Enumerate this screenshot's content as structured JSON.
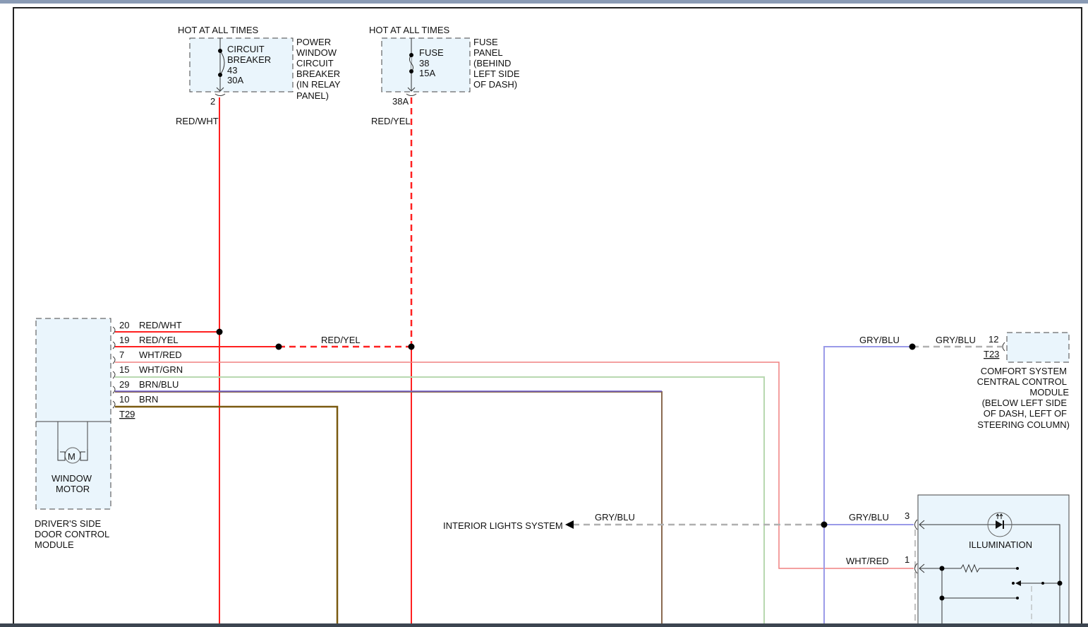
{
  "title": "Power window wiring diagram",
  "colors": {
    "red": "#ff2020",
    "wht_red": "#f08080",
    "wht_grn": "#b8d8b0",
    "brn_blu": "#6a5acd",
    "brn": "#7a5a10",
    "gry_blu": "#9a9ae8",
    "gry": "#b0b0b0",
    "module_fill": "#eaf5fc"
  },
  "power": [
    {
      "hot": "HOT AT ALL TIMES",
      "device": [
        "CIRCUIT",
        "BREAKER",
        "43",
        "30A"
      ],
      "location": [
        "POWER",
        "WINDOW",
        "CIRCUIT",
        "BREAKER",
        "(IN RELAY",
        "PANEL)"
      ],
      "pin": "2",
      "wire": "RED/WHT"
    },
    {
      "hot": "HOT AT ALL TIMES",
      "device": [
        "FUSE",
        "38",
        "15A"
      ],
      "location": [
        "FUSE",
        "PANEL",
        "(BEHIND",
        "LEFT SIDE",
        "OF DASH)"
      ],
      "pin": "38A",
      "wire": "RED/YEL"
    }
  ],
  "door_module": {
    "connector": "T29",
    "pins": [
      {
        "pin": "20",
        "wire": "RED/WHT"
      },
      {
        "pin": "19",
        "wire": "RED/YEL"
      },
      {
        "pin": "7",
        "wire": "WHT/RED"
      },
      {
        "pin": "15",
        "wire": "WHT/GRN"
      },
      {
        "pin": "29",
        "wire": "BRN/BLU"
      },
      {
        "pin": "10",
        "wire": "BRN"
      }
    ],
    "motor_symbol": "M",
    "motor_label": [
      "WINDOW",
      "MOTOR"
    ],
    "label": [
      "DRIVER'S SIDE",
      "DOOR CONTROL",
      "MODULE"
    ]
  },
  "splice_label": "RED/YEL",
  "comfort": {
    "wire_left": "GRY/BLU",
    "wire_right": "GRY/BLU",
    "pin": "12",
    "connector": "T23",
    "label": [
      "COMFORT SYSTEM",
      "CENTRAL CONTROL",
      "MODULE",
      "(BELOW LEFT SIDE",
      "OF DASH, LEFT OF",
      "STEERING COLUMN)"
    ]
  },
  "interior": {
    "label": "INTERIOR LIGHTS SYSTEM",
    "wire": "GRY/BLU"
  },
  "illumination": {
    "label": "ILLUMINATION",
    "pin3": "3",
    "wire3": "GRY/BLU",
    "pin1": "1",
    "wire1": "WHT/RED"
  }
}
